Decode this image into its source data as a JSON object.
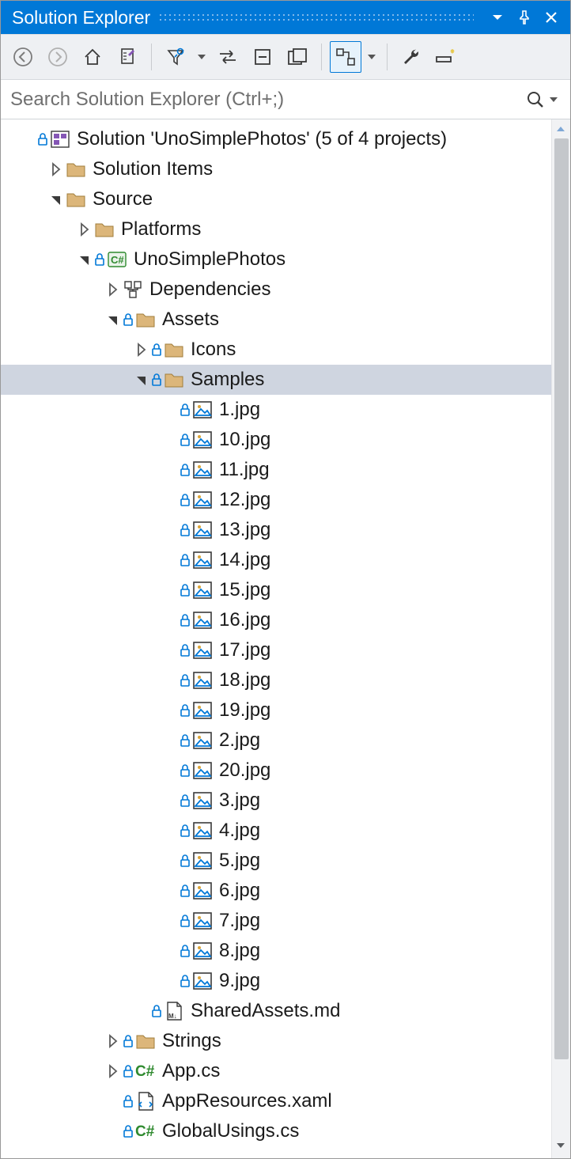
{
  "title": "Solution Explorer",
  "search": {
    "placeholder": "Search Solution Explorer (Ctrl+;)"
  },
  "toolbar_buttons": [
    "back",
    "forward",
    "home",
    "switch-views",
    "filter",
    "filter-dropdown",
    "sync",
    "collapse-all",
    "show-all",
    "track",
    "wrench",
    "properties-pane"
  ],
  "tree": [
    {
      "depth": 0,
      "arrow": "none",
      "lock": true,
      "icon": "solution",
      "label": "Solution 'UnoSimplePhotos' (5 of 4 projects)",
      "selected": false
    },
    {
      "depth": 1,
      "arrow": "closed",
      "lock": false,
      "icon": "folder",
      "label": "Solution Items",
      "selected": false
    },
    {
      "depth": 1,
      "arrow": "open",
      "lock": false,
      "icon": "folder",
      "label": "Source",
      "selected": false
    },
    {
      "depth": 2,
      "arrow": "closed",
      "lock": false,
      "icon": "folder",
      "label": "Platforms",
      "selected": false
    },
    {
      "depth": 2,
      "arrow": "open",
      "lock": true,
      "icon": "csproj",
      "label": "UnoSimplePhotos",
      "selected": false
    },
    {
      "depth": 3,
      "arrow": "closed",
      "lock": false,
      "icon": "dependencies",
      "label": "Dependencies",
      "selected": false
    },
    {
      "depth": 3,
      "arrow": "open",
      "lock": true,
      "icon": "folder",
      "label": "Assets",
      "selected": false
    },
    {
      "depth": 4,
      "arrow": "closed",
      "lock": true,
      "icon": "folder",
      "label": "Icons",
      "selected": false
    },
    {
      "depth": 4,
      "arrow": "open",
      "lock": true,
      "icon": "folder",
      "label": "Samples",
      "selected": true
    },
    {
      "depth": 5,
      "arrow": "none",
      "lock": true,
      "icon": "image",
      "label": "1.jpg",
      "selected": false
    },
    {
      "depth": 5,
      "arrow": "none",
      "lock": true,
      "icon": "image",
      "label": "10.jpg",
      "selected": false
    },
    {
      "depth": 5,
      "arrow": "none",
      "lock": true,
      "icon": "image",
      "label": "11.jpg",
      "selected": false
    },
    {
      "depth": 5,
      "arrow": "none",
      "lock": true,
      "icon": "image",
      "label": "12.jpg",
      "selected": false
    },
    {
      "depth": 5,
      "arrow": "none",
      "lock": true,
      "icon": "image",
      "label": "13.jpg",
      "selected": false
    },
    {
      "depth": 5,
      "arrow": "none",
      "lock": true,
      "icon": "image",
      "label": "14.jpg",
      "selected": false
    },
    {
      "depth": 5,
      "arrow": "none",
      "lock": true,
      "icon": "image",
      "label": "15.jpg",
      "selected": false
    },
    {
      "depth": 5,
      "arrow": "none",
      "lock": true,
      "icon": "image",
      "label": "16.jpg",
      "selected": false
    },
    {
      "depth": 5,
      "arrow": "none",
      "lock": true,
      "icon": "image",
      "label": "17.jpg",
      "selected": false
    },
    {
      "depth": 5,
      "arrow": "none",
      "lock": true,
      "icon": "image",
      "label": "18.jpg",
      "selected": false
    },
    {
      "depth": 5,
      "arrow": "none",
      "lock": true,
      "icon": "image",
      "label": "19.jpg",
      "selected": false
    },
    {
      "depth": 5,
      "arrow": "none",
      "lock": true,
      "icon": "image",
      "label": "2.jpg",
      "selected": false
    },
    {
      "depth": 5,
      "arrow": "none",
      "lock": true,
      "icon": "image",
      "label": "20.jpg",
      "selected": false
    },
    {
      "depth": 5,
      "arrow": "none",
      "lock": true,
      "icon": "image",
      "label": "3.jpg",
      "selected": false
    },
    {
      "depth": 5,
      "arrow": "none",
      "lock": true,
      "icon": "image",
      "label": "4.jpg",
      "selected": false
    },
    {
      "depth": 5,
      "arrow": "none",
      "lock": true,
      "icon": "image",
      "label": "5.jpg",
      "selected": false
    },
    {
      "depth": 5,
      "arrow": "none",
      "lock": true,
      "icon": "image",
      "label": "6.jpg",
      "selected": false
    },
    {
      "depth": 5,
      "arrow": "none",
      "lock": true,
      "icon": "image",
      "label": "7.jpg",
      "selected": false
    },
    {
      "depth": 5,
      "arrow": "none",
      "lock": true,
      "icon": "image",
      "label": "8.jpg",
      "selected": false
    },
    {
      "depth": 5,
      "arrow": "none",
      "lock": true,
      "icon": "image",
      "label": "9.jpg",
      "selected": false
    },
    {
      "depth": 4,
      "arrow": "none",
      "lock": true,
      "icon": "md",
      "label": "SharedAssets.md",
      "selected": false
    },
    {
      "depth": 3,
      "arrow": "closed",
      "lock": true,
      "icon": "folder",
      "label": "Strings",
      "selected": false
    },
    {
      "depth": 3,
      "arrow": "closed",
      "lock": true,
      "icon": "cs",
      "label": "App.cs",
      "selected": false
    },
    {
      "depth": 3,
      "arrow": "none",
      "lock": true,
      "icon": "xaml",
      "label": "AppResources.xaml",
      "selected": false
    },
    {
      "depth": 3,
      "arrow": "none",
      "lock": true,
      "icon": "cs",
      "label": "GlobalUsings.cs",
      "selected": false
    }
  ],
  "indent_base": 22,
  "indent_step": 36
}
